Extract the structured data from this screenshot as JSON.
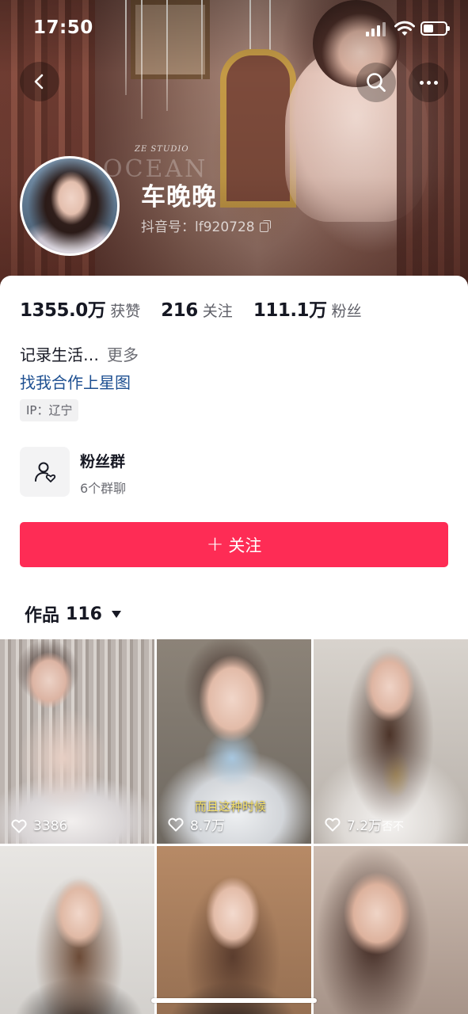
{
  "status_bar": {
    "time": "17:50"
  },
  "cover": {
    "studio_text": "ZE STUDIO",
    "watermark_text": "OCEAN"
  },
  "profile": {
    "name": "车晚晚",
    "douyin_id": "抖音号：lf920728"
  },
  "stats": [
    {
      "value": "1355.0万",
      "label": "获赞"
    },
    {
      "value": "216",
      "label": "关注"
    },
    {
      "value": "111.1万",
      "label": "粉丝"
    }
  ],
  "bio": {
    "text": "记录生活…",
    "more": "更多"
  },
  "collab_link": "找我合作上星图",
  "ip_location": "IP：辽宁",
  "fan_group": {
    "title": "粉丝群",
    "subtitle": "6个群聊"
  },
  "follow_button": {
    "icon": "plus",
    "label": "关注"
  },
  "works_tab": {
    "label": "作品",
    "count": "116"
  },
  "videos": [
    {
      "likes": "3386"
    },
    {
      "likes": "8.7万",
      "caption": "而且这种时候"
    },
    {
      "likes": "7.2万",
      "caption": "否不"
    },
    {
      "likes": ""
    },
    {
      "likes": ""
    },
    {
      "likes": ""
    }
  ],
  "colors": {
    "accent": "#fe2c55",
    "link": "#1d4f91",
    "text": "#161823",
    "secondary": "#5f6068"
  },
  "icons": [
    "back-arrow-icon",
    "search-icon",
    "more-icon",
    "copy-icon",
    "group-icon",
    "heart-icon",
    "caret-down-icon"
  ]
}
